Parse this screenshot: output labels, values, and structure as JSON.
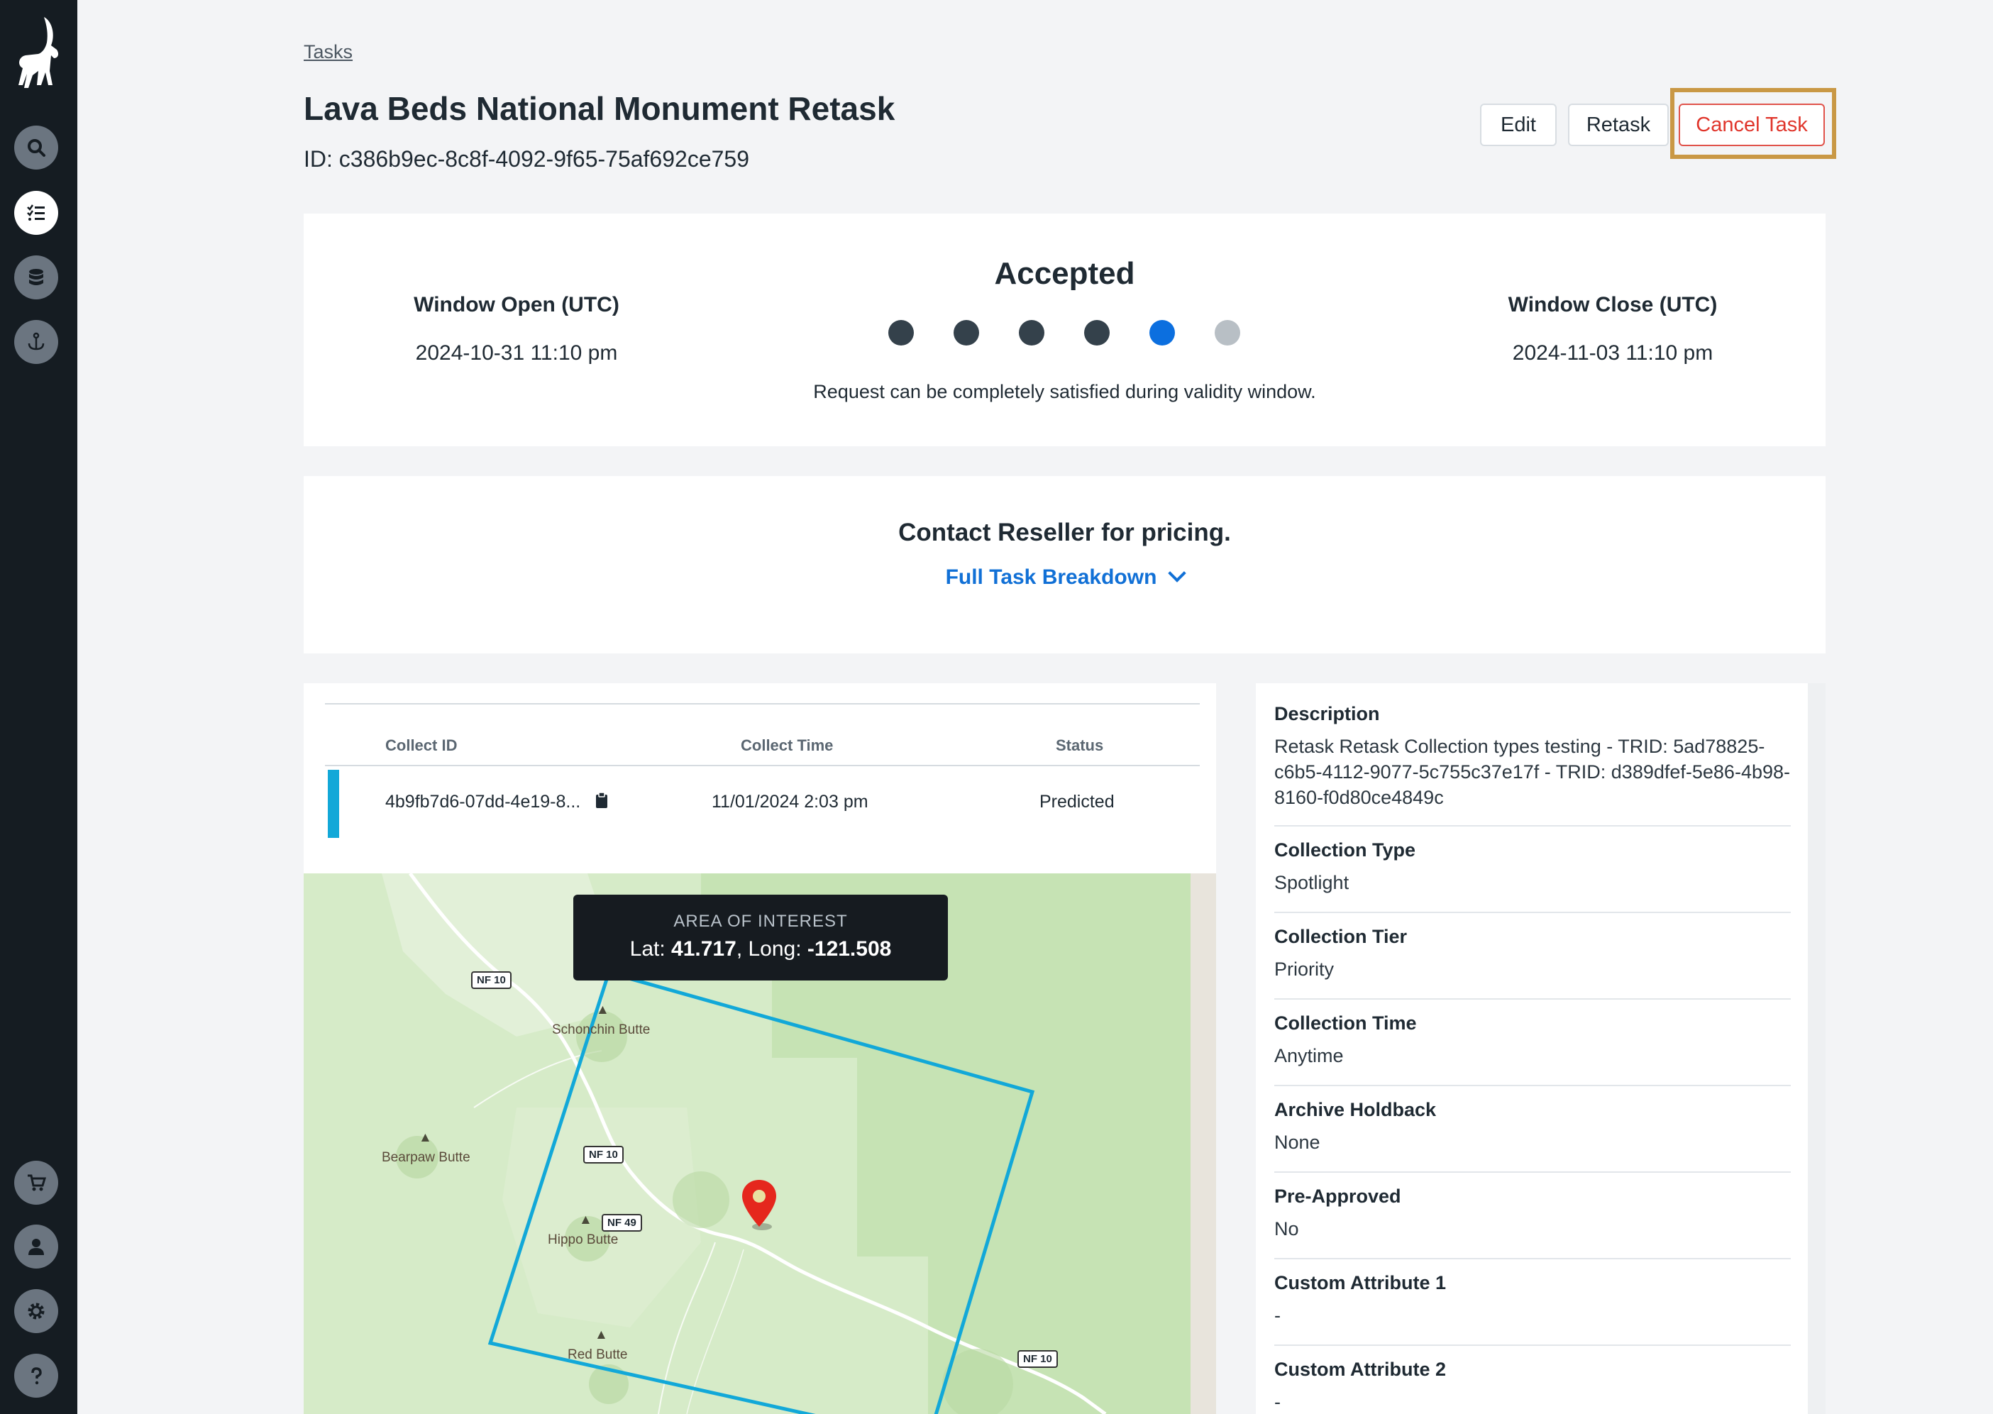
{
  "sidebar": {
    "logo": "ibex-logo",
    "top_items": [
      {
        "name": "search",
        "icon": "search-icon"
      },
      {
        "name": "tasks",
        "icon": "tasks-list-icon",
        "active": true
      },
      {
        "name": "data",
        "icon": "database-icon"
      },
      {
        "name": "anchor",
        "icon": "anchor-icon"
      }
    ],
    "bottom_items": [
      {
        "name": "cart",
        "icon": "cart-icon"
      },
      {
        "name": "account",
        "icon": "user-icon"
      },
      {
        "name": "settings",
        "icon": "gear-icon"
      },
      {
        "name": "help",
        "icon": "help-icon"
      }
    ]
  },
  "header": {
    "breadcrumb": "Tasks",
    "title": "Lava Beds National Monument Retask",
    "id_text": "ID: c386b9ec-8c8f-4092-9f65-75af692ce759",
    "buttons": {
      "edit": "Edit",
      "retask": "Retask",
      "cancel": "Cancel Task"
    }
  },
  "status": {
    "window_open_label": "Window Open (UTC)",
    "window_open_value": "2024-10-31 11:10 pm",
    "state": "Accepted",
    "steps_total": 6,
    "steps_current": 5,
    "description": "Request can be completely satisfied during validity window.",
    "window_close_label": "Window Close (UTC)",
    "window_close_value": "2024-11-03 11:10 pm"
  },
  "pricing": {
    "text": "Contact Reseller for pricing.",
    "breakdown_label": "Full Task Breakdown"
  },
  "collects": {
    "headers": [
      "Collect ID",
      "Collect Time",
      "Status"
    ],
    "rows": [
      {
        "id": "4b9fb7d6-07dd-4e19-8...",
        "time": "11/01/2024 2:03 pm",
        "status": "Predicted"
      }
    ]
  },
  "map": {
    "tooltip_label": "AREA OF INTEREST",
    "lat_label": "Lat: ",
    "lat": "41.717",
    "long_label": ", Long: ",
    "long": "-121.508",
    "places": [
      "Schonchin Butte",
      "Bearpaw Butte",
      "Hippo Butte",
      "Red Butte"
    ],
    "roads": [
      "NF 10",
      "NF 10",
      "NF 49",
      "NF 10"
    ],
    "aoi_color": "#12a8d8",
    "pin_color": "#e5271d"
  },
  "details": [
    {
      "label": "Description",
      "value": "Retask Retask Collection types testing - TRID: 5ad78825-c6b5-4112-9077-5c755c37e17f - TRID: d389dfef-5e86-4b98-8160-f0d80ce4849c"
    },
    {
      "label": "Collection Type",
      "value": "Spotlight"
    },
    {
      "label": "Collection Tier",
      "value": "Priority"
    },
    {
      "label": "Collection Time",
      "value": "Anytime"
    },
    {
      "label": "Archive Holdback",
      "value": "None"
    },
    {
      "label": "Pre-Approved",
      "value": "No"
    },
    {
      "label": "Custom Attribute 1",
      "value": "-"
    },
    {
      "label": "Custom Attribute 2",
      "value": "-"
    }
  ]
}
